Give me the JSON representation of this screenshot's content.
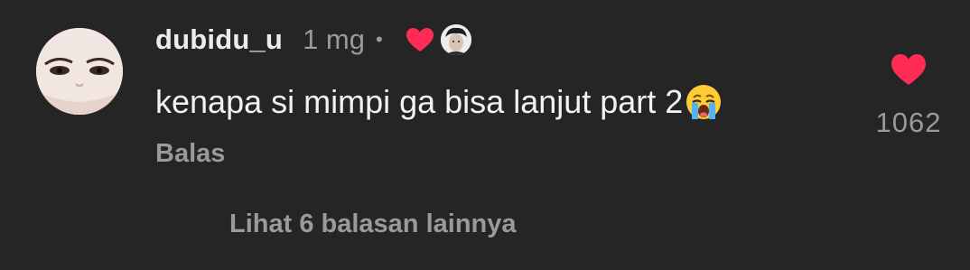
{
  "comment": {
    "username": "dubidu_u",
    "time": "1 mg",
    "separator": "•",
    "text": "kenapa si mimpi ga bisa lanjut part 2",
    "emoji": "loudly-crying-face-emoji",
    "creator_liked_icon": "heart-icon",
    "reply_label": "Balas",
    "like_count": "1062",
    "like_icon": "heart-icon",
    "liked": true
  },
  "replies": {
    "view_more_label": "Lihat 6 balasan lainnya"
  },
  "colors": {
    "background": "#252525",
    "primary_text": "#f2f2f2",
    "secondary_text": "#9a9a9a",
    "heart_red": "#fe2c55"
  }
}
